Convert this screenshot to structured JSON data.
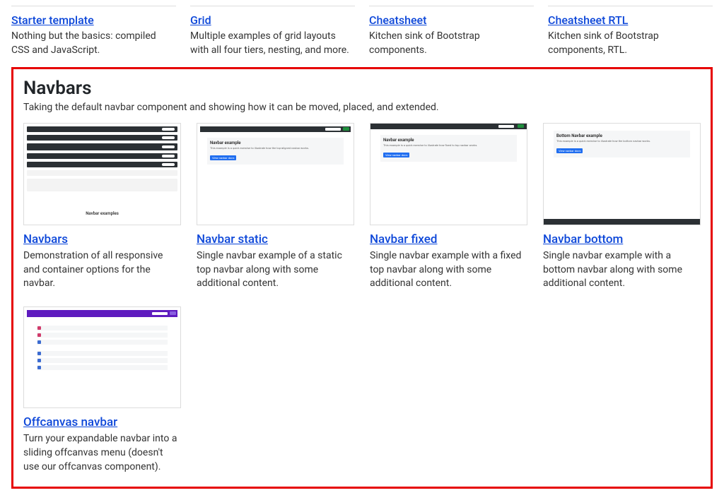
{
  "top_links": [
    {
      "title": "Starter template",
      "desc": "Nothing but the basics: compiled CSS and JavaScript."
    },
    {
      "title": "Grid",
      "desc": "Multiple examples of grid layouts with all four tiers, nesting, and more."
    },
    {
      "title": "Cheatsheet",
      "desc": "Kitchen sink of Bootstrap components."
    },
    {
      "title": "Cheatsheet RTL",
      "desc": "Kitchen sink of Bootstrap components, RTL."
    }
  ],
  "section": {
    "heading": "Navbars",
    "sub": "Taking the default navbar component and showing how it can be moved, placed, and extended."
  },
  "cards": [
    {
      "title": "Navbars",
      "desc": "Demonstration of all responsive and container options for the navbar."
    },
    {
      "title": "Navbar static",
      "desc": "Single navbar example of a static top navbar along with some additional content."
    },
    {
      "title": "Navbar fixed",
      "desc": "Single navbar example with a fixed top navbar along with some additional content."
    },
    {
      "title": "Navbar bottom",
      "desc": "Single navbar example with a bottom navbar along with some additional content."
    },
    {
      "title": "Offcanvas navbar",
      "desc": "Turn your expandable navbar into a sliding offcanvas menu (doesn't use our offcanvas component)."
    }
  ],
  "thumb_text": {
    "navbar_examples": "Navbar examples",
    "navbar_example": "Navbar example",
    "bottom_navbar_example": "Bottom Navbar example",
    "view_button": "View navbar docs"
  }
}
